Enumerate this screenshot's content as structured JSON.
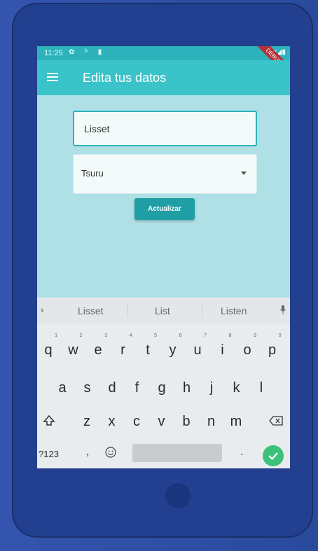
{
  "status_bar": {
    "time": "11:25",
    "icons": "✿ ᵇ ▮",
    "right_icons": "▾◢▮",
    "debug_label": "DEBUG"
  },
  "app_bar": {
    "title": "Edita tus datos",
    "menu_icon": "hamburger-menu-icon"
  },
  "form": {
    "name_value": "Lisset",
    "select_value": "Tsuru",
    "update_button": "Actualizar"
  },
  "keyboard": {
    "suggestions": [
      "Lisset",
      "List",
      "Listen"
    ],
    "row1": [
      {
        "k": "q",
        "n": "1"
      },
      {
        "k": "w",
        "n": "2"
      },
      {
        "k": "e",
        "n": "3"
      },
      {
        "k": "r",
        "n": "4"
      },
      {
        "k": "t",
        "n": "5"
      },
      {
        "k": "y",
        "n": "6"
      },
      {
        "k": "u",
        "n": "7"
      },
      {
        "k": "i",
        "n": "8"
      },
      {
        "k": "o",
        "n": "9"
      },
      {
        "k": "p",
        "n": "0"
      }
    ],
    "row2": [
      "a",
      "s",
      "d",
      "f",
      "g",
      "h",
      "j",
      "k",
      "l"
    ],
    "row3": [
      "z",
      "x",
      "c",
      "v",
      "b",
      "n",
      "m"
    ],
    "symbols_key": "?123",
    "comma_key": ",",
    "period_key": ".",
    "accent_color": "#3cc17a"
  },
  "colors": {
    "app_bar": "#3bc3ca",
    "screen_bg": "#aee0e6",
    "button": "#1f9ea6"
  }
}
